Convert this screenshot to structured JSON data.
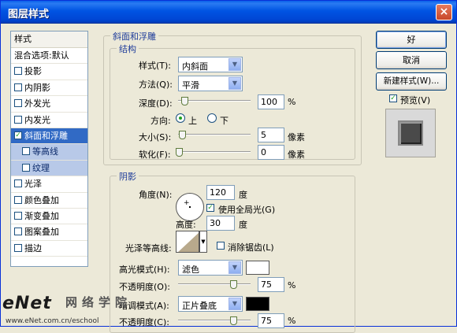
{
  "window": {
    "title": "图层样式",
    "close_label": "×"
  },
  "sidebar": {
    "header": "样式",
    "items": [
      {
        "label": "混合选项:默认",
        "checkbox": false,
        "checked": false
      },
      {
        "label": "投影",
        "checkbox": true,
        "checked": false
      },
      {
        "label": "内阴影",
        "checkbox": true,
        "checked": false
      },
      {
        "label": "外发光",
        "checkbox": true,
        "checked": false
      },
      {
        "label": "内发光",
        "checkbox": true,
        "checked": false
      },
      {
        "label": "斜面和浮雕",
        "checkbox": true,
        "checked": true
      },
      {
        "label": "等高线",
        "checkbox": true,
        "checked": false
      },
      {
        "label": "纹理",
        "checkbox": true,
        "checked": false
      },
      {
        "label": "光泽",
        "checkbox": true,
        "checked": false
      },
      {
        "label": "颜色叠加",
        "checkbox": true,
        "checked": false
      },
      {
        "label": "渐变叠加",
        "checkbox": true,
        "checked": false
      },
      {
        "label": "图案叠加",
        "checkbox": true,
        "checked": false
      },
      {
        "label": "描边",
        "checkbox": true,
        "checked": false
      }
    ]
  },
  "bevel": {
    "group_title": "斜面和浮雕",
    "structure_title": "结构",
    "style_label": "样式(T):",
    "style_value": "内斜面",
    "technique_label": "方法(Q):",
    "technique_value": "平滑",
    "depth_label": "深度(D):",
    "depth_value": "100",
    "depth_unit": "%",
    "direction_label": "方向:",
    "dir_up": "上",
    "dir_down": "下",
    "size_label": "大小(S):",
    "size_value": "5",
    "size_unit": "像素",
    "soften_label": "软化(F):",
    "soften_value": "0",
    "soften_unit": "像素"
  },
  "shading": {
    "title": "阴影",
    "angle_label": "角度(N):",
    "angle_value": "120",
    "angle_unit": "度",
    "global_light_label": "使用全局光(G)",
    "altitude_label": "高度:",
    "altitude_value": "30",
    "altitude_unit": "度",
    "gloss_label": "光泽等高线:",
    "antialias_label": "消除锯齿(L)",
    "highlight_label": "高光模式(H):",
    "highlight_value": "滤色",
    "highlight_color": "#FFFFFF",
    "opacity1_label": "不透明度(O):",
    "opacity1_value": "75",
    "opacity1_unit": "%",
    "shadow_label": "暗调模式(A):",
    "shadow_value": "正片叠底",
    "shadow_color": "#000000",
    "opacity2_label": "不透明度(C):",
    "opacity2_value": "75",
    "opacity2_unit": "%"
  },
  "buttons": {
    "ok": "好",
    "cancel": "取消",
    "new_style": "新建样式(W)...",
    "preview": "预览(V)"
  },
  "watermark": {
    "brand": "eNet",
    "cn": "网络学院",
    "url": "www.eNet.com.cn/eschool"
  }
}
